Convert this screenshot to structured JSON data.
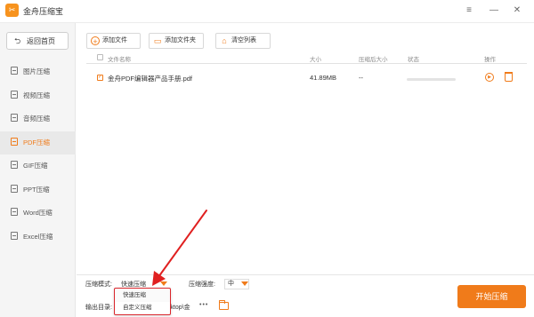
{
  "app": {
    "title": "金舟压缩宝",
    "logo_glyph": "✂"
  },
  "window_controls": {
    "menu": "≡",
    "minimize": "—",
    "close": "✕"
  },
  "sidebar": {
    "back_label": "返回首页",
    "items": [
      {
        "label": "图片压缩",
        "active": false
      },
      {
        "label": "视频压缩",
        "active": false
      },
      {
        "label": "音频压缩",
        "active": false
      },
      {
        "label": "PDF压缩",
        "active": true
      },
      {
        "label": "GIF压缩",
        "active": false
      },
      {
        "label": "PPT压缩",
        "active": false
      },
      {
        "label": "Word压缩",
        "active": false
      },
      {
        "label": "Excel压缩",
        "active": false
      }
    ]
  },
  "toolbar": {
    "add_file": "添加文件",
    "add_folder": "添加文件夹",
    "clear_list": "清空列表"
  },
  "table": {
    "headers": {
      "name": "文件名称",
      "size": "大小",
      "compressed_size": "压缩后大小",
      "status": "状态",
      "actions": "操作"
    },
    "rows": [
      {
        "name": "金舟PDF编辑器产品手册.pdf",
        "size": "41.89MB",
        "compressed_size": "--",
        "progress": 0,
        "checked": true
      }
    ]
  },
  "bottom": {
    "mode_label": "压缩模式:",
    "mode_value": "快速压缩",
    "strength_label": "压缩强度:",
    "strength_value": "中",
    "output_label": "输出目录:",
    "output_value": "esktop\\金",
    "output_dots": "•••",
    "start_button": "开始压缩"
  },
  "mode_dropdown": {
    "options": [
      "快速压缩",
      "自定义压缩"
    ]
  },
  "colors": {
    "accent": "#f07b1a",
    "highlight_box": "#d9262c",
    "annotation_arrow": "#e02020"
  }
}
